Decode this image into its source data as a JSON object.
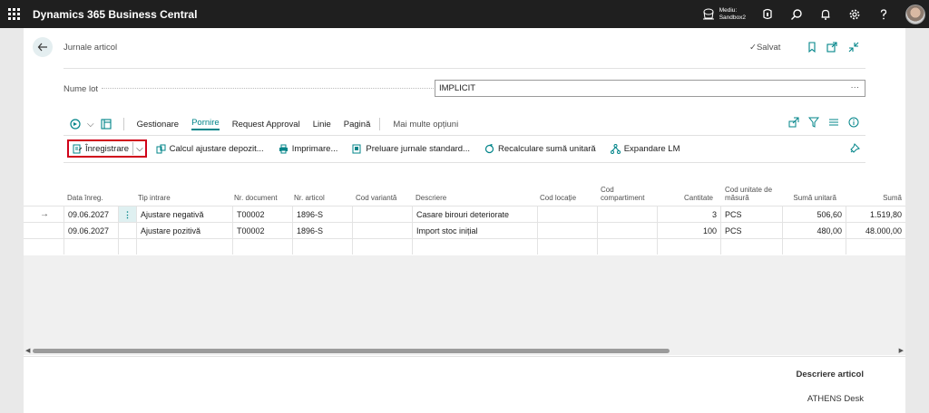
{
  "app": {
    "title": "Dynamics 365 Business Central"
  },
  "topbar": {
    "env_label": "Mediu:",
    "env_name": "Sandbox2"
  },
  "page": {
    "title": "Jurnale articol",
    "saved": "Salvat"
  },
  "batch": {
    "label": "Nume lot",
    "value": "IMPLICIT",
    "ellipsis": "···"
  },
  "actions": {
    "items": [
      "Gestionare",
      "Pornire",
      "Request Approval",
      "Linie",
      "Pagină"
    ],
    "active_index": 1,
    "more": "Mai multe opțiuni"
  },
  "toolbar": {
    "post": "Înregistrare",
    "calc": "Calcul ajustare depozit...",
    "print": "Imprimare...",
    "get_std": "Preluare jurnale standard...",
    "recalc": "Recalculare sumă unitară",
    "explode": "Expandare LM"
  },
  "columns": {
    "date": "Data înreg.",
    "entry_type": "Tip intrare",
    "doc_no": "Nr. document",
    "item_no": "Nr. articol",
    "variant": "Cod variantă",
    "desc": "Descriere",
    "location": "Cod locație",
    "bin_1": "Cod",
    "bin_2": "compartiment",
    "qty": "Cantitate",
    "uom_1": "Cod unitate de",
    "uom_2": "măsură",
    "unit_amt": "Sumă unitară",
    "amount": "Sumă"
  },
  "rows": [
    {
      "date": "09.06.2027",
      "entry_type": "Ajustare negativă",
      "doc_no": "T00002",
      "item_no": "1896-S",
      "variant": "",
      "desc": "Casare birouri deteriorate",
      "location": "",
      "bin": "",
      "qty": "3",
      "uom": "PCS",
      "unit_amt": "506,60",
      "amount": "1.519,80"
    },
    {
      "date": "09.06.2027",
      "entry_type": "Ajustare pozitivă",
      "doc_no": "T00002",
      "item_no": "1896-S",
      "variant": "",
      "desc": "Import stoc inițial",
      "location": "",
      "bin": "",
      "qty": "100",
      "uom": "PCS",
      "unit_amt": "480,00",
      "amount": "48.000,00"
    }
  ],
  "footer": {
    "title": "Descriere articol",
    "value": "ATHENS Desk"
  },
  "colors": {
    "accent": "#008489",
    "highlight": "#d0021b",
    "topbar": "#1f1f1f"
  }
}
